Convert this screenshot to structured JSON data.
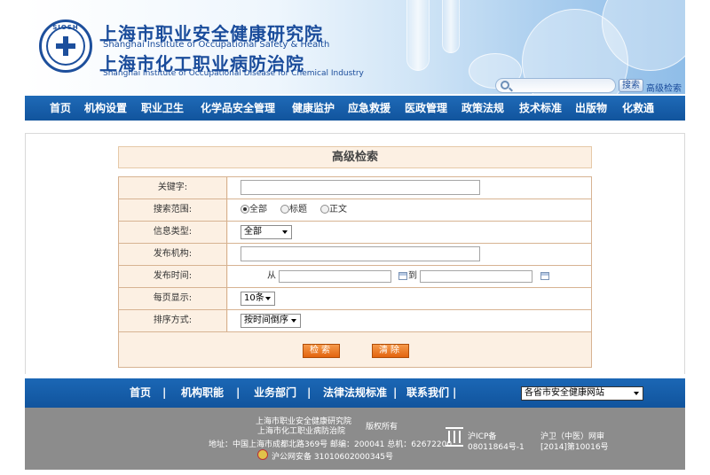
{
  "header": {
    "cn_title_1": "上海市职业安全健康研究院",
    "en_title_1": "Shanghai Institute of Occupational Safety & Health",
    "cn_title_2": "上海市化工职业病防治院",
    "en_title_2": "Shanghai Institute of Occupational Disease for Chemical Industry",
    "logo_abbr": "SIOSH",
    "search_placeholder": "",
    "search_button": "搜索",
    "advanced_search_link": "高级检索"
  },
  "nav": {
    "items": [
      "首页",
      "机构设置",
      "职业卫生",
      "化学品安全管理",
      "健康监护",
      "应急救援",
      "医政管理",
      "政策法规",
      "技术标准",
      "出版物",
      "化救通"
    ]
  },
  "form": {
    "title": "高级检索",
    "keyword": {
      "label": "关键字:",
      "value": ""
    },
    "scope": {
      "label": "搜索范围:",
      "options": [
        "全部",
        "标题",
        "正文"
      ],
      "selected": 0
    },
    "info_type": {
      "label": "信息类型:",
      "value": "全部"
    },
    "publisher": {
      "label": "发布机构:",
      "value": ""
    },
    "publish_time": {
      "label": "发布时间:",
      "from_label": "从",
      "to_label": "到",
      "from_value": "",
      "to_value": ""
    },
    "per_page": {
      "label": "每页显示:",
      "value": "10条"
    },
    "sort": {
      "label": "排序方式:",
      "value": "按时间倒序"
    },
    "search_button": "检索",
    "clear_button": "清除"
  },
  "footer": {
    "links": [
      "首页",
      "机构职能",
      "业务部门",
      "法律法规标准",
      "联系我们"
    ],
    "separator": "|",
    "site_select": "各省市安全健康网站",
    "org_name_1": "上海市职业安全健康研究院",
    "org_name_2": "上海市化工职业病防治院",
    "rights": "版权所有",
    "address": "地址：中国上海市成都北路369号  邮编：200041  总机：62672200",
    "police_record": "沪公网安备 31010602000345号",
    "icp_line1": "沪ICP备",
    "icp_line2": "08011864号-1",
    "health_line1": "沪卫（中医）网审",
    "health_line2": "[2014]第10016号"
  },
  "colors": {
    "nav_blue": "#1558a3",
    "title_blue": "#1a4c9b",
    "form_bg": "#fcf0e3",
    "button_orange": "#e8731d",
    "footer_gray": "#8c8c8c"
  }
}
